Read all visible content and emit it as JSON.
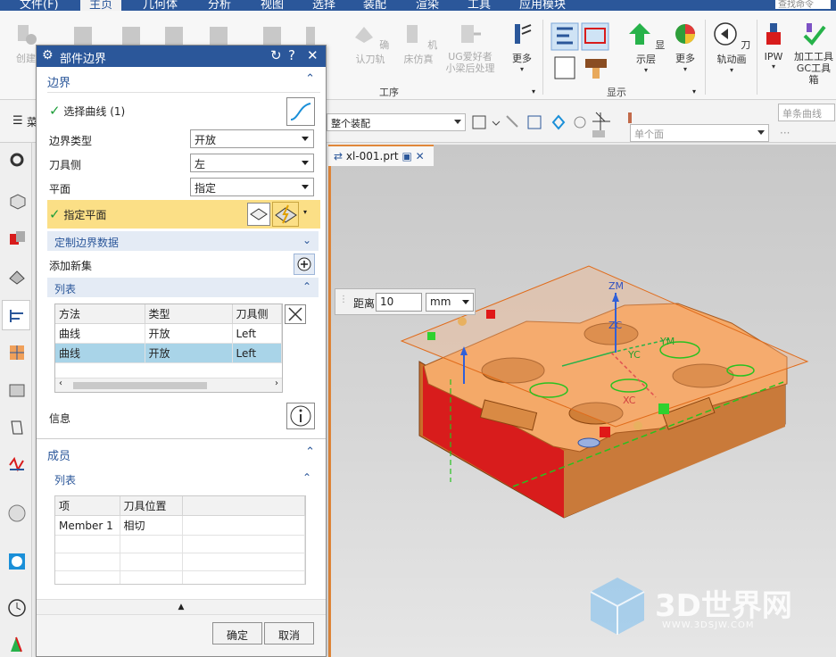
{
  "menu": {
    "items": [
      "文件(F)",
      "主页",
      "几何体",
      "分析",
      "视图",
      "选择",
      "装配",
      "渲染",
      "工具",
      "应用模块"
    ],
    "active_index": 1,
    "search_placeholder": "查找命令"
  },
  "ribbon": {
    "buttons_left": [
      "创建",
      "确认刀轨",
      "机床仿真",
      "UG爱好者",
      "小梁后处理"
    ],
    "more_label": "更多",
    "group_work": "工序",
    "show_layer": "显示层",
    "more2": "更多",
    "toolpath_anim": "刀轨动画",
    "ipw": "IPW",
    "machining_tool_l1": "加工工具",
    "machining_tool_l2": "GC工具箱",
    "group_display": "显示"
  },
  "toolbar2": {
    "assembly_combo": "整个装配",
    "single_curve": "单条曲线",
    "single_face": "单个面",
    "menu_glyph": "☰",
    "menu_label": "菜"
  },
  "graphics": {
    "tab_label": "xl-001.prt",
    "distance_label": "距离",
    "distance_value": "10",
    "distance_unit": "mm",
    "axes": {
      "zm": "ZM",
      "zc": "ZC",
      "ym": "YM",
      "yc": "YC",
      "xc": "XC"
    }
  },
  "dialog": {
    "title": "部件边界",
    "section_boundary": "边界",
    "select_curve": "选择曲线 (1)",
    "boundary_type_label": "边界类型",
    "boundary_type_value": "开放",
    "tool_side_label": "刀具侧",
    "tool_side_value": "左",
    "plane_label": "平面",
    "plane_value": "指定",
    "specify_plane": "指定平面",
    "custom_boundary": "定制边界数据",
    "add_new_set": "添加新集",
    "list_header": "列表",
    "list_columns": [
      "方法",
      "类型",
      "刀具侧"
    ],
    "list_rows": [
      [
        "曲线",
        "开放",
        "Left"
      ],
      [
        "曲线",
        "开放",
        "Left"
      ]
    ],
    "info_label": "信息",
    "section_members": "成员",
    "members_list_header": "列表",
    "members_columns": [
      "项",
      "刀具位置"
    ],
    "members_rows": [
      [
        "Member 1",
        "相切"
      ]
    ],
    "ok": "确定",
    "cancel": "取消"
  },
  "watermark": {
    "brand": "3D世界网",
    "url": "WWW.3DSJW.COM"
  },
  "colors": {
    "title_bar": "#2b579a",
    "highlight": "#fbdf86",
    "selected_row": "#a9d4e8",
    "part_face": "#f0a05a",
    "part_side": "#c96e2a",
    "red_face": "#d81c1c"
  }
}
